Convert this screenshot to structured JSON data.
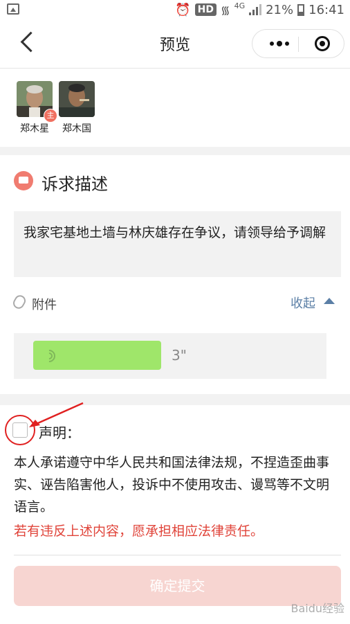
{
  "status_bar": {
    "network": "4G",
    "hd_badge": "HD",
    "battery": "21%",
    "time": "16:41"
  },
  "navbar": {
    "title": "预览"
  },
  "participants": [
    {
      "name": "郑木星",
      "badge": "主"
    },
    {
      "name": "郑木国"
    }
  ],
  "description": {
    "title": "诉求描述",
    "text": "我家宅基地土墙与林庆雄存在争议，请领导给予调解"
  },
  "attachment": {
    "label": "附件",
    "collapse_label": "收起",
    "voice_duration": "3\""
  },
  "declaration": {
    "label": "声明：",
    "checked": false,
    "text": "本人承诺遵守中华人民共和国法律法规，不捏造歪曲事实、诬告陷害他人，投诉中不使用攻击、谩骂等不文明语言。",
    "warning": "若有违反上述内容，愿承担相应法律责任。"
  },
  "submit": {
    "label": "确定提交"
  },
  "watermark": "Baidu经验",
  "colors": {
    "accent_red": "#e0443a",
    "link_blue": "#5b7fa6",
    "voice_green": "#9fe66a",
    "submit_disabled": "#f7d5d1"
  }
}
